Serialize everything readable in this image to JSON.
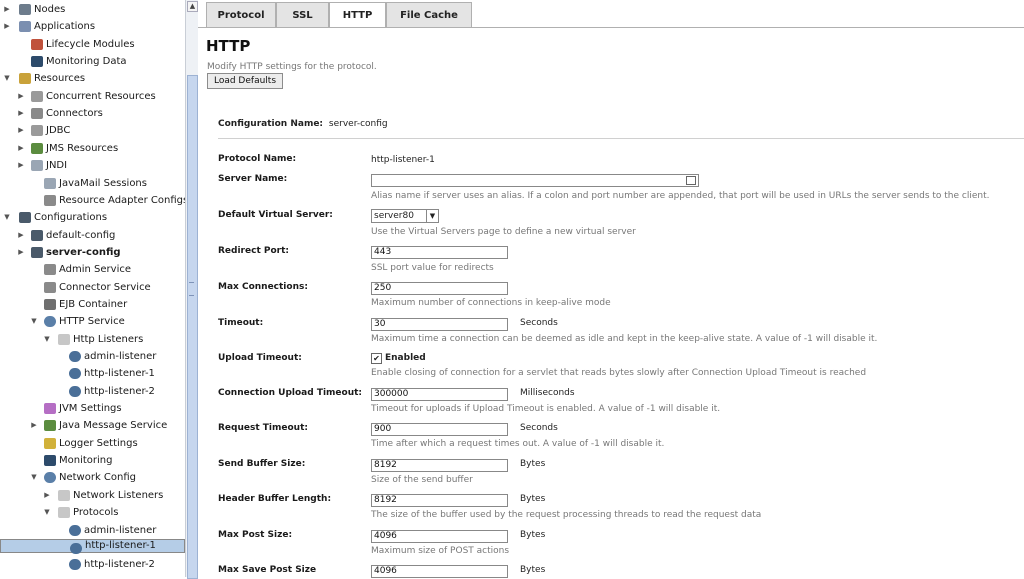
{
  "tree": {
    "items": [
      {
        "label": "Nodes",
        "icon": "nodes-icon",
        "twisty": "▶"
      },
      {
        "label": "Applications",
        "icon": "applications-icon",
        "twisty": "▶"
      },
      {
        "label": "Lifecycle Modules",
        "icon": "lifecycle-icon",
        "twisty": ""
      },
      {
        "label": "Monitoring Data",
        "icon": "monitor-icon",
        "twisty": ""
      },
      {
        "label": "Resources",
        "icon": "resources-icon",
        "twisty": "▼"
      },
      {
        "label": "Concurrent Resources",
        "icon": "database-icon",
        "twisty": "▶"
      },
      {
        "label": "Connectors",
        "icon": "connector-icon",
        "twisty": "▶"
      },
      {
        "label": "JDBC",
        "icon": "database-icon",
        "twisty": "▶"
      },
      {
        "label": "JMS Resources",
        "icon": "jms-icon",
        "twisty": "▶"
      },
      {
        "label": "JNDI",
        "icon": "jndi-icon",
        "twisty": "▶"
      },
      {
        "label": "JavaMail Sessions",
        "icon": "mail-icon",
        "twisty": ""
      },
      {
        "label": "Resource Adapter Configs",
        "icon": "connector-icon",
        "twisty": ""
      },
      {
        "label": "Configurations",
        "icon": "config-icon",
        "twisty": "▼"
      },
      {
        "label": "default-config",
        "icon": "config-icon",
        "twisty": "▶"
      },
      {
        "label": "server-config",
        "icon": "config-icon",
        "twisty": "▶"
      },
      {
        "label": "Admin Service",
        "icon": "service-icon",
        "twisty": ""
      },
      {
        "label": "Connector Service",
        "icon": "service-icon",
        "twisty": ""
      },
      {
        "label": "EJB Container",
        "icon": "ejb-icon",
        "twisty": ""
      },
      {
        "label": "HTTP Service",
        "icon": "globe-icon",
        "twisty": "▼"
      },
      {
        "label": "Http Listeners",
        "icon": "folder-icon",
        "twisty": "▼"
      },
      {
        "label": "admin-listener",
        "icon": "listener-icon",
        "twisty": ""
      },
      {
        "label": "http-listener-1",
        "icon": "listener-icon",
        "twisty": ""
      },
      {
        "label": "http-listener-2",
        "icon": "listener-icon",
        "twisty": ""
      },
      {
        "label": "JVM Settings",
        "icon": "jvm-icon",
        "twisty": ""
      },
      {
        "label": "Java Message Service",
        "icon": "jms-icon",
        "twisty": "▶"
      },
      {
        "label": "Logger Settings",
        "icon": "logger-icon",
        "twisty": ""
      },
      {
        "label": "Monitoring",
        "icon": "monitor-icon",
        "twisty": ""
      },
      {
        "label": "Network Config",
        "icon": "globe-icon",
        "twisty": "▼"
      },
      {
        "label": "Network Listeners",
        "icon": "folder-icon",
        "twisty": "▶"
      },
      {
        "label": "Protocols",
        "icon": "folder-icon",
        "twisty": "▼"
      },
      {
        "label": "admin-listener",
        "icon": "listener-icon",
        "twisty": ""
      },
      {
        "label": "http-listener-1",
        "icon": "listener-icon",
        "twisty": ""
      },
      {
        "label": "http-listener-2",
        "icon": "listener-icon",
        "twisty": ""
      }
    ]
  },
  "tabs": [
    "Protocol",
    "SSL",
    "HTTP",
    "File Cache"
  ],
  "active_tab": "HTTP",
  "page": {
    "title": "HTTP",
    "subtitle": "Modify HTTP settings for the protocol.",
    "load_defaults": "Load Defaults",
    "config_name_label": "Configuration Name:",
    "config_name_value": "server-config"
  },
  "fields": {
    "protocol_name": {
      "label": "Protocol Name:",
      "value": "http-listener-1"
    },
    "server_name": {
      "label": "Server Name:",
      "value": "",
      "help": "Alias name if server uses an alias. If a colon and port number are appended, that port will be used in URLs the server sends to the client."
    },
    "default_virtual_server": {
      "label": "Default Virtual Server:",
      "value": "server80",
      "help": "Use the Virtual Servers page to define a new virtual server"
    },
    "redirect_port": {
      "label": "Redirect Port:",
      "value": "443",
      "help": "SSL port value for redirects"
    },
    "max_connections": {
      "label": "Max Connections:",
      "value": "250",
      "help": "Maximum number of connections in keep-alive mode"
    },
    "timeout": {
      "label": "Timeout:",
      "value": "30",
      "unit": "Seconds",
      "help": "Maximum time a connection can be deemed as idle and kept in the keep-alive state. A value of -1 will disable it."
    },
    "upload_timeout": {
      "label": "Upload Timeout:",
      "check": "✔",
      "checkbox_label": "Enabled",
      "help": "Enable closing of connection for a servlet that reads bytes slowly after Connection Upload Timeout is reached"
    },
    "connection_upload_timeout": {
      "label": "Connection Upload Timeout:",
      "value": "300000",
      "unit": "Milliseconds",
      "help": "Timeout for uploads if Upload Timeout is enabled. A value of -1 will disable it."
    },
    "request_timeout": {
      "label": "Request Timeout:",
      "value": "900",
      "unit": "Seconds",
      "help": "Time after which a request times out. A value of -1 will disable it."
    },
    "send_buffer_size": {
      "label": "Send Buffer Size:",
      "value": "8192",
      "unit": "Bytes",
      "help": "Size of the send buffer"
    },
    "header_buffer_length": {
      "label": "Header Buffer Length:",
      "value": "8192",
      "unit": "Bytes",
      "help": "The size of the buffer used by the request processing threads to read the request data"
    },
    "max_post_size": {
      "label": "Max Post Size:",
      "value": "4096",
      "unit": "Bytes",
      "help": "Maximum size of POST actions"
    },
    "max_save_post_size": {
      "label": "Max Save Post Size",
      "value": "4096",
      "unit": "Bytes"
    }
  }
}
